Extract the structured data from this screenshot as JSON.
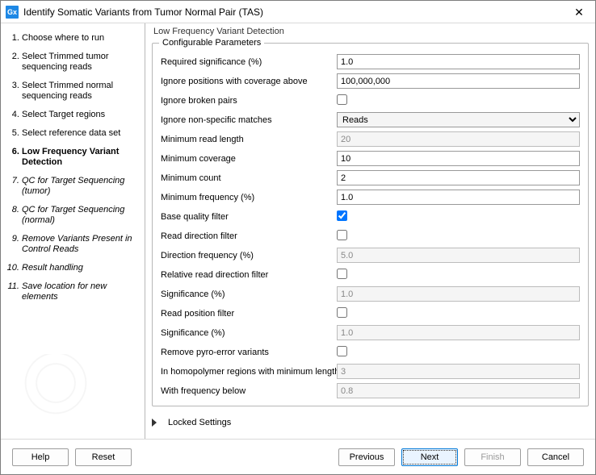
{
  "window": {
    "app_icon": "Gx",
    "title": "Identify Somatic Variants from Tumor Normal Pair (TAS)"
  },
  "sidebar": {
    "steps": [
      {
        "label": "Choose where to run",
        "state": "past"
      },
      {
        "label": "Select Trimmed tumor sequencing reads",
        "state": "past"
      },
      {
        "label": "Select Trimmed normal sequencing reads",
        "state": "past"
      },
      {
        "label": "Select Target regions",
        "state": "past"
      },
      {
        "label": "Select reference data set",
        "state": "past"
      },
      {
        "label": "Low Frequency Variant Detection",
        "state": "current"
      },
      {
        "label": "QC for Target Sequencing (tumor)",
        "state": "future"
      },
      {
        "label": "QC for Target Sequencing (normal)",
        "state": "future"
      },
      {
        "label": "Remove Variants Present in Control Reads",
        "state": "future"
      },
      {
        "label": "Result handling",
        "state": "future"
      },
      {
        "label": "Save location for new elements",
        "state": "future"
      }
    ]
  },
  "panel": {
    "title": "Low Frequency Variant Detection",
    "fieldset": "Configurable Parameters",
    "locked": "Locked Settings",
    "params": [
      {
        "label": "Required significance (%)",
        "type": "text",
        "value": "1.0",
        "enabled": true
      },
      {
        "label": "Ignore positions with coverage above",
        "type": "text",
        "value": "100,000,000",
        "enabled": true
      },
      {
        "label": "Ignore broken pairs",
        "type": "check",
        "value": false,
        "enabled": true
      },
      {
        "label": "Ignore non-specific matches",
        "type": "select",
        "value": "Reads",
        "enabled": true
      },
      {
        "label": "Minimum read length",
        "type": "text",
        "value": "20",
        "enabled": false
      },
      {
        "label": "Minimum coverage",
        "type": "text",
        "value": "10",
        "enabled": true
      },
      {
        "label": "Minimum count",
        "type": "text",
        "value": "2",
        "enabled": true
      },
      {
        "label": "Minimum frequency (%)",
        "type": "text",
        "value": "1.0",
        "enabled": true
      },
      {
        "label": "Base quality filter",
        "type": "check",
        "value": true,
        "enabled": true
      },
      {
        "label": "Read direction filter",
        "type": "check",
        "value": false,
        "enabled": true
      },
      {
        "label": "Direction frequency (%)",
        "type": "text",
        "value": "5.0",
        "enabled": false
      },
      {
        "label": "Relative read direction filter",
        "type": "check",
        "value": false,
        "enabled": true
      },
      {
        "label": "Significance (%)",
        "type": "text",
        "value": "1.0",
        "enabled": false
      },
      {
        "label": "Read position filter",
        "type": "check",
        "value": false,
        "enabled": true
      },
      {
        "label": "Significance (%)",
        "type": "text",
        "value": "1.0",
        "enabled": false
      },
      {
        "label": "Remove pyro-error variants",
        "type": "check",
        "value": false,
        "enabled": true
      },
      {
        "label": "In homopolymer regions with minimum length",
        "type": "text",
        "value": "3",
        "enabled": false
      },
      {
        "label": "With frequency below",
        "type": "text",
        "value": "0.8",
        "enabled": false
      }
    ]
  },
  "footer": {
    "help": "Help",
    "reset": "Reset",
    "previous": "Previous",
    "next": "Next",
    "finish": "Finish",
    "cancel": "Cancel"
  }
}
